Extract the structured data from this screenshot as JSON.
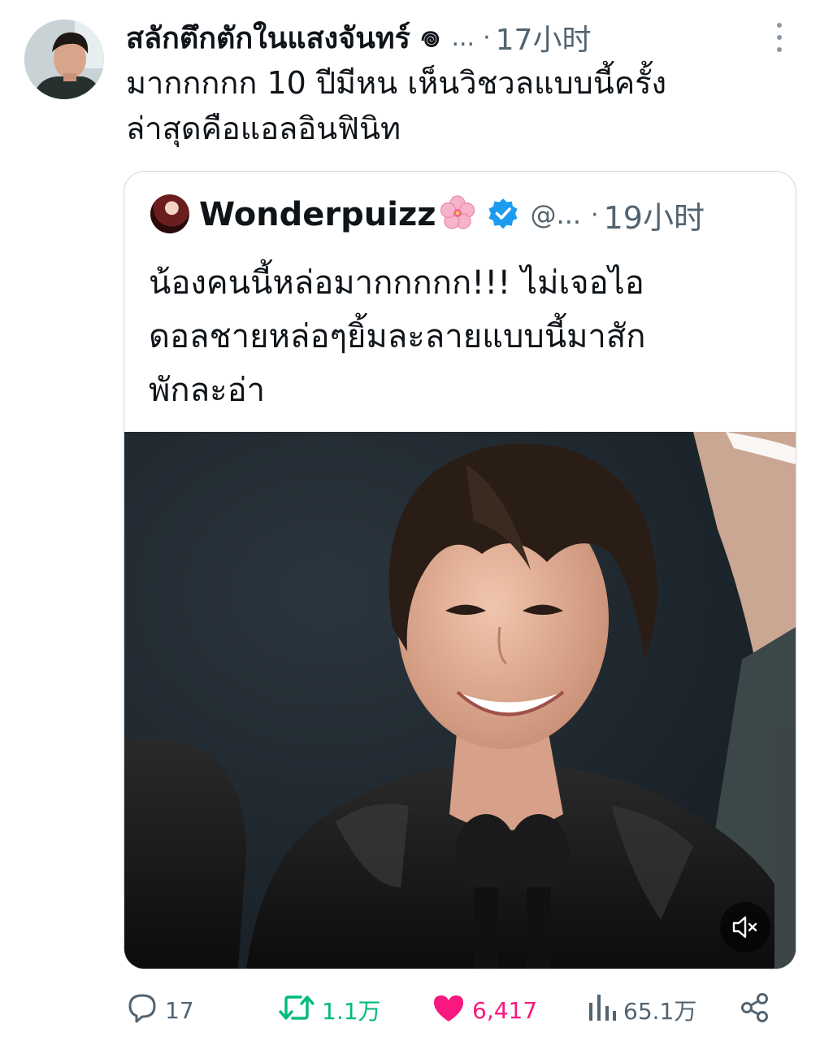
{
  "tweet": {
    "display_name": "สลักตึกตักในแสงจันทร์ 𖦹",
    "handle_truncated": "...",
    "separator": "·",
    "timestamp": "17小时",
    "text_line1": "มากกกกก 10 ปีมีหน เห็นวิชวลแบบนี้ครั้ง",
    "text_line2": "ล่าสุดคือแอลอินฟินิท"
  },
  "quote": {
    "display_name": "Wonderpuizz",
    "handle_truncated": "@...",
    "separator": "·",
    "timestamp": "19小时",
    "text_line1": "น้องคนนี้หล่อมากกกกก!!! ไม่เจอไอ",
    "text_line2": "ดอลชายหล่อๆยิ้มละลายแบบนี้มาสัก",
    "text_line3": "พักละอ่า"
  },
  "actions": {
    "reply_count": "17",
    "retweet_count": "1.1万",
    "like_count": "6,417",
    "views_count": "65.1万"
  },
  "colors": {
    "text_primary": "#0f1419",
    "text_secondary": "#536471",
    "retweet_active": "#00ba7c",
    "like_active": "#f91880",
    "verified": "#1d9bf0"
  },
  "icons": [
    "more-icon",
    "blossom-icon",
    "verified-icon",
    "mute-icon",
    "reply-icon",
    "retweet-icon",
    "like-icon",
    "views-icon",
    "share-icon"
  ]
}
